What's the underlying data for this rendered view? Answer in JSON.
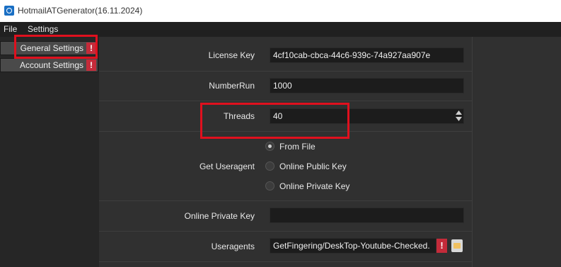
{
  "window": {
    "title": "HotmailATGenerator(16.11.2024)"
  },
  "menu": {
    "file": "File",
    "settings": "Settings"
  },
  "sidebar": {
    "items": [
      {
        "label": "General Settings",
        "warn": "!"
      },
      {
        "label": "Account Settings",
        "warn": "!"
      }
    ]
  },
  "form": {
    "license_key": {
      "label": "License Key",
      "value": "4cf10cab-cbca-44c6-939c-74a927aa907e"
    },
    "number_run": {
      "label": "NumberRun",
      "value": "1000"
    },
    "threads": {
      "label": "Threads",
      "value": "40"
    },
    "get_useragent": {
      "label": "Get Useragent",
      "options": [
        "From File",
        "Online Public Key",
        "Online Private Key"
      ],
      "selected": "From File"
    },
    "online_private_key": {
      "label": "Online Private Key",
      "value": ""
    },
    "useragents": {
      "label": "Useragents",
      "value": "GetFingering/DeskTop-Youtube-Checked.",
      "warn": "!"
    }
  },
  "colors": {
    "highlight": "#e0101e",
    "warning": "#c42b3a",
    "background": "#303030"
  }
}
